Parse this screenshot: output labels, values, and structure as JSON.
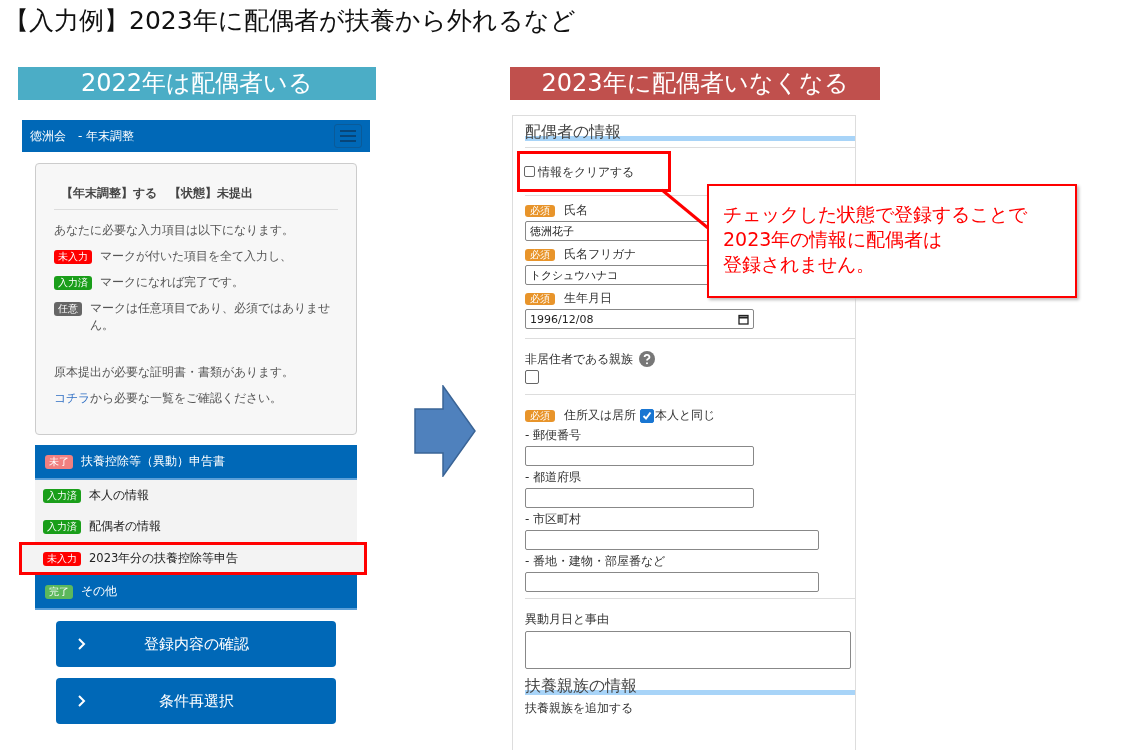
{
  "slide_title": "【入力例】2023年に配偶者が扶養から外れるなど",
  "left": {
    "caption": "2022年は配偶者いる",
    "app_title": "徳洲会　- 年末調整",
    "summary": {
      "status": "【年末調整】する　【状態】未提出",
      "intro": "あなたに必要な入力項目は以下になります。",
      "legend": [
        {
          "badge": "未入力",
          "color": "#ff0000",
          "text": "マークが付いた項目を全て入力し、"
        },
        {
          "badge": "入力済",
          "color": "#1a9e1a",
          "text": "マークになれば完了です。"
        },
        {
          "badge": "任意",
          "color": "#666666",
          "text": "マークは任意項目であり、必須ではありません。"
        }
      ],
      "note": "原本提出が必要な証明書・書類があります。",
      "link": "コチラ",
      "link_rest": "から必要な一覧をご確認ください。"
    },
    "sections": [
      {
        "badge": "未了",
        "color": "#f08080",
        "title": "扶養控除等（異動）申告書",
        "items": [
          {
            "badge": "入力済",
            "color": "#1a9e1a",
            "label": "本人の情報",
            "highlighted": false
          },
          {
            "badge": "入力済",
            "color": "#1a9e1a",
            "label": "配偶者の情報",
            "highlighted": false
          },
          {
            "badge": "未入力",
            "color": "#ff0000",
            "label": "2023年分の扶養控除等申告",
            "highlighted": true
          }
        ]
      },
      {
        "badge": "完了",
        "color": "#5cb85c",
        "title": "その他"
      }
    ],
    "buttons": [
      "登録内容の確認",
      "条件再選択"
    ]
  },
  "right": {
    "caption": "2023年に配偶者いなくなる",
    "heading": "配偶者の情報",
    "clear_checkbox": {
      "label": "情報をクリアする",
      "checked": false,
      "highlighted": true
    },
    "fields": [
      {
        "kind": "text",
        "badge": "必須",
        "label": "氏名",
        "value": "徳洲花子"
      },
      {
        "kind": "text",
        "badge": "必須",
        "label": "氏名フリガナ",
        "value": "トクシュウハナコ"
      },
      {
        "kind": "date",
        "badge": "必須",
        "label": "生年月日",
        "value": "1996/12/08"
      },
      {
        "kind": "checkbox",
        "label": "非居住者である親族",
        "checked": false
      },
      {
        "kind": "address",
        "badge": "必須",
        "label": "住所又は居所",
        "same_label": "本人と同じ",
        "same_checked": true,
        "subfields": [
          "- 郵便番号",
          "- 都道府県",
          "- 市区町村",
          "- 番地・建物・部屋番など"
        ]
      },
      {
        "kind": "textarea",
        "label": "異動月日と事由"
      }
    ],
    "heading2": "扶養親族の情報",
    "add_text": "扶養親族を追加する",
    "callout": [
      "チェックした状態で登録することで",
      "2023年の情報に配偶者は",
      "登録されません。"
    ]
  }
}
